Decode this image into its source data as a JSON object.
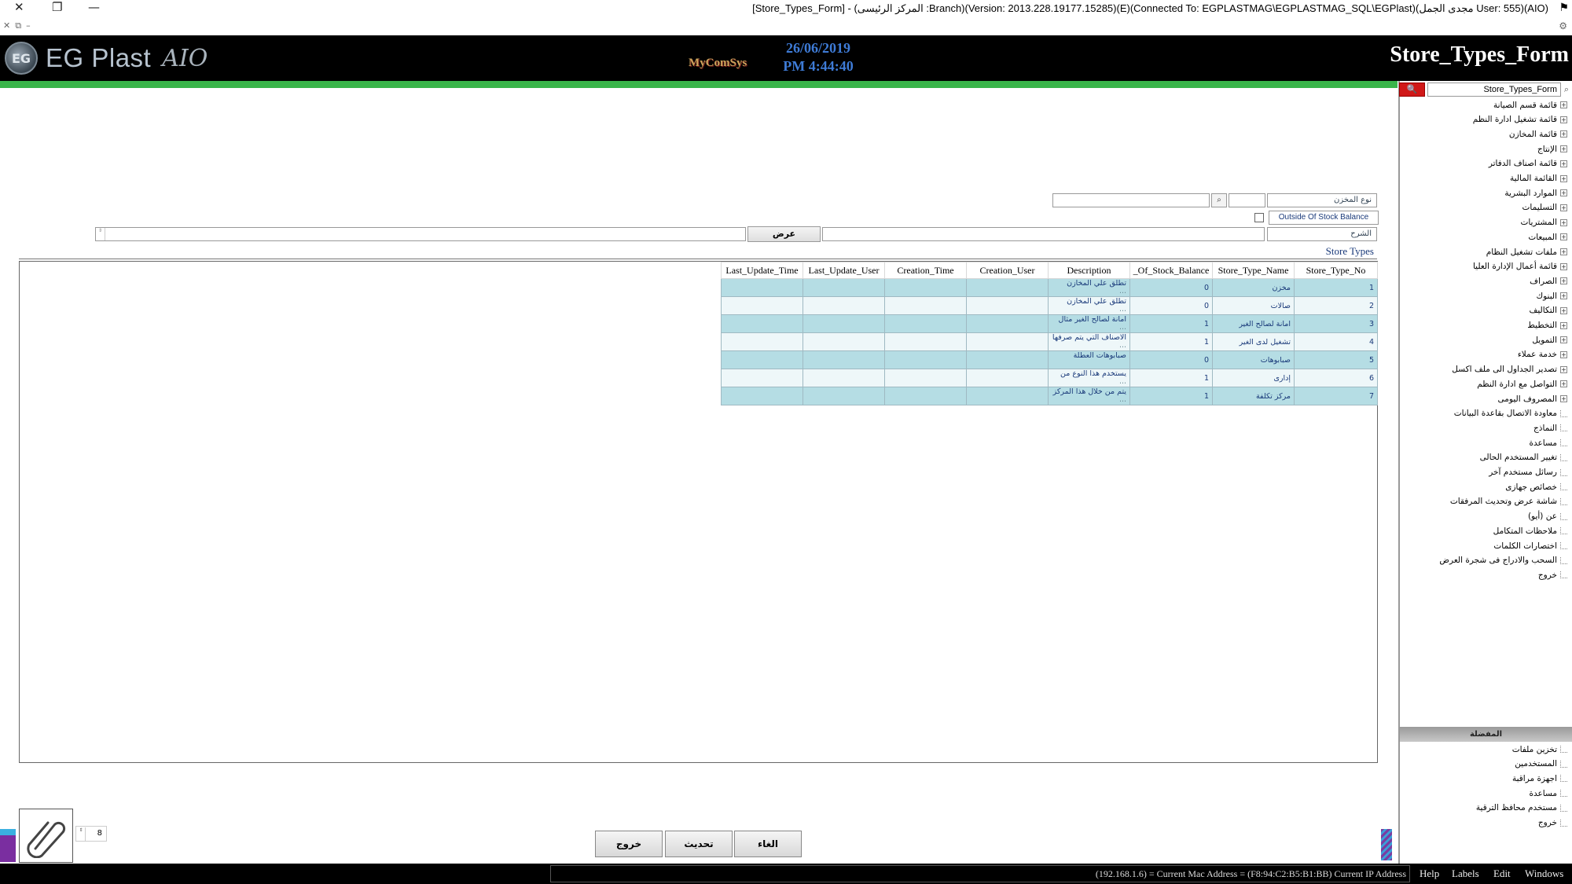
{
  "window": {
    "title": "[Store_Types_Form] - (المركز الرئيسى :Branch)(Version: 2013.228.19177.15285)(E)(Connected To: EGPLASTMAG\\EGPLASTMAG_SQL\\EGPlast)(مجدى الجمل User: 555)(AIO)",
    "close_glyph": "✕",
    "restore_glyph": "❐",
    "minimize_glyph": "—",
    "flag_glyph": "⚑",
    "sub_icons": "✕⧉–",
    "settings_glyph": "⚙"
  },
  "header": {
    "logo_mark": "EG",
    "logo_text": "EG Plast",
    "logo_suffix": "AIO",
    "brand": "MyComSys",
    "date": "26/06/2019",
    "time": "PM 4:44:40",
    "form_title": "Store_Types_Form"
  },
  "colors": {
    "header_bg": "#000000",
    "green_bar": "#39b54a",
    "search_red": "#d01818",
    "row_odd": "#b5dde4",
    "row_even": "#eef7f9",
    "date_blue": "#3e7bd6",
    "text_blue": "#1a3a7a"
  },
  "sidebar": {
    "search_value": "Store_Types_Form",
    "search_btn_icon": "search-icon",
    "search_btn_glyph": "🔍",
    "search_icon_glyph": "⌕",
    "tree": [
      {
        "label": "قائمة قسم الصيانة",
        "expandable": true
      },
      {
        "label": "قائمة تشغيل ادارة النظم",
        "expandable": true
      },
      {
        "label": "قائمة المخازن",
        "expandable": true
      },
      {
        "label": "الإنتاج",
        "expandable": true
      },
      {
        "label": "قائمة اصناف الدفاتر",
        "expandable": true
      },
      {
        "label": "القائمة المالية",
        "expandable": true
      },
      {
        "label": "الموارد البشرية",
        "expandable": true
      },
      {
        "label": "التسليمات",
        "expandable": true
      },
      {
        "label": "المشتريات",
        "expandable": true
      },
      {
        "label": "المبيعات",
        "expandable": true
      },
      {
        "label": "ملفات تشغيل النظام",
        "expandable": true
      },
      {
        "label": "قائمة أعمال الإدارة العليا",
        "expandable": true
      },
      {
        "label": "الصراف",
        "expandable": true
      },
      {
        "label": "البنوك",
        "expandable": true
      },
      {
        "label": "التكاليف",
        "expandable": true
      },
      {
        "label": "التخطيط",
        "expandable": true
      },
      {
        "label": "التمويل",
        "expandable": true
      },
      {
        "label": "خدمة عملاء",
        "expandable": true
      },
      {
        "label": "تصدير الجداول الى ملف اكسل",
        "expandable": true
      },
      {
        "label": "التواصل مع ادارة النظم",
        "expandable": true
      },
      {
        "label": "المصروف اليومى",
        "expandable": true
      },
      {
        "label": "معاودة الاتصال بقاعدة البيانات",
        "expandable": false
      },
      {
        "label": "النماذج",
        "expandable": false
      },
      {
        "label": "مساعدة",
        "expandable": false
      },
      {
        "label": "تغيير المستخدم الحالى",
        "expandable": false
      },
      {
        "label": "رسائل مستخدم آخر",
        "expandable": false
      },
      {
        "label": "خصائص جهازى",
        "expandable": false
      },
      {
        "label": "شاشة عرض وتحديث المرفقات",
        "expandable": false
      },
      {
        "label": "عن (أيو)",
        "expandable": false
      },
      {
        "label": "ملاحظات المتكامل",
        "expandable": false
      },
      {
        "label": "اختصارات الكلمات",
        "expandable": false
      },
      {
        "label": "السحب والادراج فى شجرة العرض",
        "expandable": false
      },
      {
        "label": "خروج",
        "expandable": false
      }
    ],
    "favorites_header": "المفضلة",
    "favorites": [
      "تخزين ملفات",
      "المستخدمين",
      "اجهزة مراقبة",
      "مساعدة",
      "مستخدم محافظ الترقية",
      "خروج"
    ],
    "expand_glyph": "+"
  },
  "form": {
    "store_type_label": "نوع المخزن",
    "lookup_glyph": "⌕",
    "outside_stock_label": "Outside Of Stock Balance",
    "description_label": "الشرح",
    "view_button": "عرض",
    "spin_glyph": "⇕"
  },
  "grid": {
    "title": "Store Types",
    "columns": [
      "Last_Update_Time",
      "Last_Update_User",
      "Creation_Time",
      "Creation_User",
      "Description",
      "_Of_Stock_Balance",
      "Store_Type_Name",
      "Store_Type_No"
    ],
    "rows": [
      {
        "no": "1",
        "name": "مخزن",
        "balance": "0",
        "desc": "تطلق علي المخازن",
        "desc2": "..."
      },
      {
        "no": "2",
        "name": "صالات",
        "balance": "0",
        "desc": "تطلق علي المخازن",
        "desc2": "..."
      },
      {
        "no": "3",
        "name": "امانة لصالح الغير",
        "balance": "1",
        "desc": "امانة لصالح الغير مثال",
        "desc2": "..."
      },
      {
        "no": "4",
        "name": "تشغيل لدى الغير",
        "balance": "1",
        "desc": "الاصناف التي يتم صرفها",
        "desc2": "..."
      },
      {
        "no": "5",
        "name": "صبابوهات",
        "balance": "0",
        "desc": "صبابوهات العطلة",
        "desc2": ""
      },
      {
        "no": "6",
        "name": "إدارى",
        "balance": "1",
        "desc": "يستخدم هذا النوع من",
        "desc2": "..."
      },
      {
        "no": "7",
        "name": "مركز تكلفة",
        "balance": "1",
        "desc": "يتم من خلال هذا المركز",
        "desc2": "..."
      }
    ]
  },
  "footer": {
    "exit_button": "خروج",
    "refresh_button": "تحديث",
    "cancel_button": "الغاء",
    "attachment_icon": "paperclip-icon",
    "page_spin_glyph": "⇕",
    "page_value": "8"
  },
  "statusbar": {
    "info": "(192.168.1.6) = Current Mac Address = (F8:94:C2:B5:B1:BB) Current IP Address",
    "menu": [
      "Help",
      "Labels",
      "Edit",
      "Windows"
    ]
  }
}
